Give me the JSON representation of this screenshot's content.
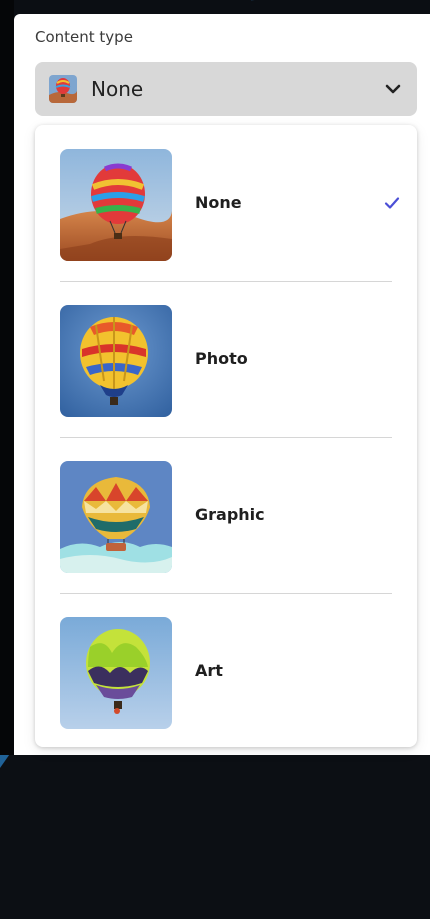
{
  "content_type": {
    "label": "Content type",
    "selected_value": "None",
    "icon": "chevron-down-icon"
  },
  "options": [
    {
      "label": "None",
      "selected": true,
      "thumb": "balloon-desert-thumbnail"
    },
    {
      "label": "Photo",
      "selected": false,
      "thumb": "balloon-photo-thumbnail"
    },
    {
      "label": "Graphic",
      "selected": false,
      "thumb": "balloon-graphic-thumbnail"
    },
    {
      "label": "Art",
      "selected": false,
      "thumb": "balloon-art-thumbnail"
    }
  ],
  "colors": {
    "accent_check": "#4b4fd6",
    "picker_bg": "#d8d8d8"
  }
}
